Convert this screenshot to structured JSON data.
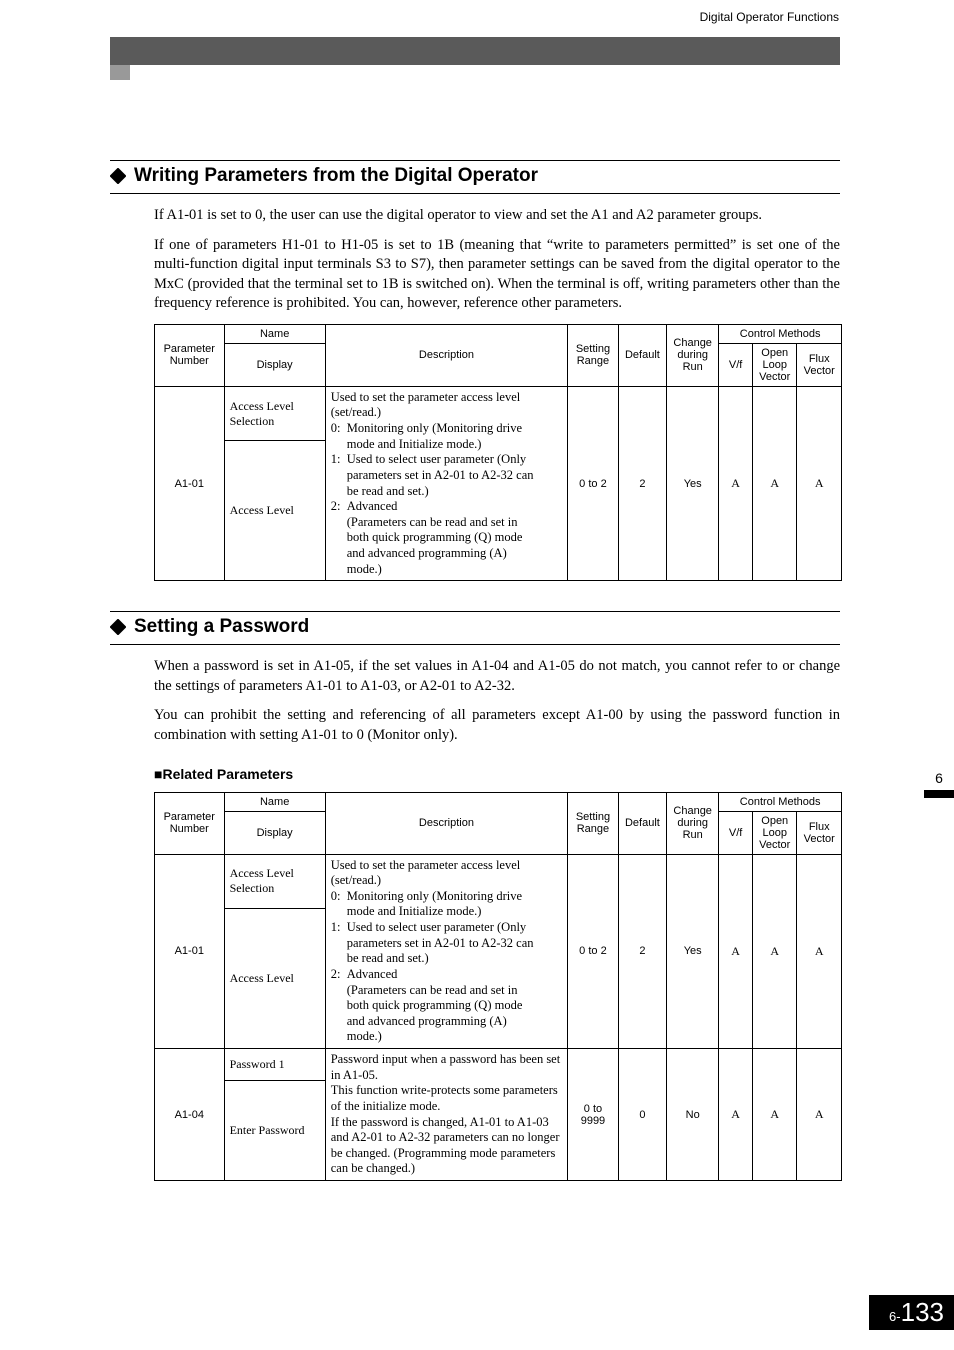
{
  "header": {
    "right": "Digital Operator Functions"
  },
  "section1": {
    "title": "Writing Parameters from the Digital Operator",
    "p1": "If A1-01 is set to 0, the user can use the digital operator to view and set the A1 and A2 parameter groups.",
    "p2": "If one of parameters H1-01 to H1-05 is set to 1B (meaning that “write to parameters permitted” is set one of the multi-function digital input terminals S3 to S7), then parameter settings can be saved from the digital operator to the MxC (provided that the terminal set to 1B is switched on). When the terminal is off, writing parameters other than the frequency reference is prohibited. You can, however, reference other parameters."
  },
  "section2": {
    "title": "Setting a Password",
    "p1": "When a password is set in A1-05, if the set values in A1-04 and A1-05 do not match, you cannot refer to or change the settings of parameters A1-01 to A1-03, or A2-01 to A2-32.",
    "p2": "You can prohibit the setting and referencing of all parameters except A1-00 by using the password function in combination with setting A1-01 to 0 (Monitor only).",
    "subhead": "■Related Parameters"
  },
  "table_headers": {
    "param": "Parameter Number",
    "name": "Name",
    "display": "Display",
    "desc": "Description",
    "sr": "Setting Range",
    "def": "Default",
    "chg": "Change during Run",
    "cm": "Control Methods",
    "vf": "V/f",
    "olv": "Open Loop Vector",
    "flux": "Flux Vector"
  },
  "rows": {
    "a101": {
      "param": "A1-01",
      "name": "Access Level Selection",
      "display": "Access Level",
      "desc_intro": "Used to set the parameter access level (set/read.)",
      "d0": "Monitoring only (Monitoring drive mode and Initialize mode.)",
      "d1": "Used to select user parameter (Only parameters set in A2-01 to A2-32 can be read and set.)",
      "d2": "Advanced\n(Parameters can be read and set in both quick programming (Q) mode and advanced programming (A) mode.)",
      "sr": "0 to 2",
      "def": "2",
      "chg": "Yes",
      "vf": "A",
      "olv": "A",
      "flux": "A"
    },
    "a104": {
      "param": "A1-04",
      "name": "Password 1",
      "display": "Enter Password",
      "desc": "Password input when a password has been set in A1-05.\nThis function write-protects some parameters of the initialize mode.\nIf the password is changed, A1-01 to A1-03 and A2-01 to A2-32 parameters can no longer be changed. (Programming mode parameters can be changed.)",
      "sr": "0 to 9999",
      "def": "0",
      "chg": "No",
      "vf": "A",
      "olv": "A",
      "flux": "A"
    }
  },
  "side": {
    "chapter": "6"
  },
  "footer": {
    "pre": "6-",
    "page": "133"
  }
}
